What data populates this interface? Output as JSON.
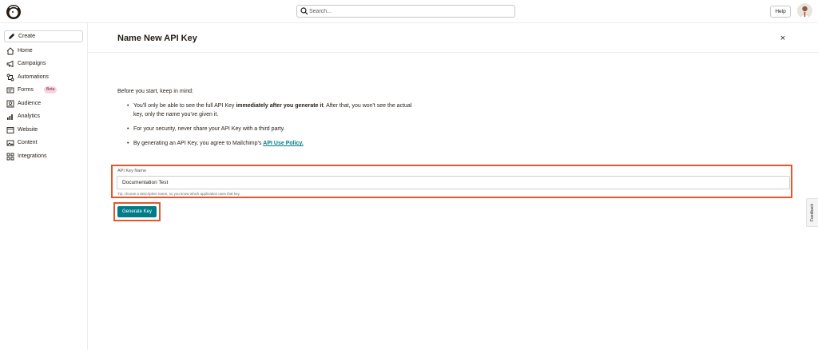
{
  "header": {
    "search_placeholder": "Search...",
    "help_label": "Help",
    "icons": {
      "logo": "mailchimp-logo",
      "search": "search-icon",
      "avatar": "user-avatar"
    }
  },
  "sidebar": {
    "create_label": "Create",
    "items": [
      {
        "label": "Home",
        "icon": "home-icon"
      },
      {
        "label": "Campaigns",
        "icon": "megaphone-icon"
      },
      {
        "label": "Automations",
        "icon": "automations-icon"
      },
      {
        "label": "Forms",
        "icon": "forms-icon",
        "badge": "Beta"
      },
      {
        "label": "Audience",
        "icon": "audience-icon"
      },
      {
        "label": "Analytics",
        "icon": "analytics-icon"
      },
      {
        "label": "Website",
        "icon": "website-icon"
      },
      {
        "label": "Content",
        "icon": "content-icon"
      },
      {
        "label": "Integrations",
        "icon": "integrations-icon"
      }
    ]
  },
  "main": {
    "title": "Name New API Key",
    "close_glyph": "×",
    "intro": "Before you start, keep in mind:",
    "bullets": {
      "b1_pre": "You'll only be able to see the full API Key ",
      "b1_bold": "immediately after you generate it",
      "b1_post": ". After that, you won't see the actual key, only the name you've given it.",
      "b2": "For your security, never share your API Key with a third party.",
      "b3_pre": "By generating an API Key, you agree to Mailchimp's ",
      "b3_link": "API Use Policy."
    },
    "field": {
      "label": "API Key Name",
      "value": "Documentation Test",
      "tip": "Tip: choose a descriptive name, so you know which application uses that key."
    },
    "generate_label": "Generate Key"
  },
  "feedback_label": "Feedback",
  "colors": {
    "accent": "#007c89",
    "highlight": "#e3572b",
    "beta_bg": "#f6d5e0"
  }
}
